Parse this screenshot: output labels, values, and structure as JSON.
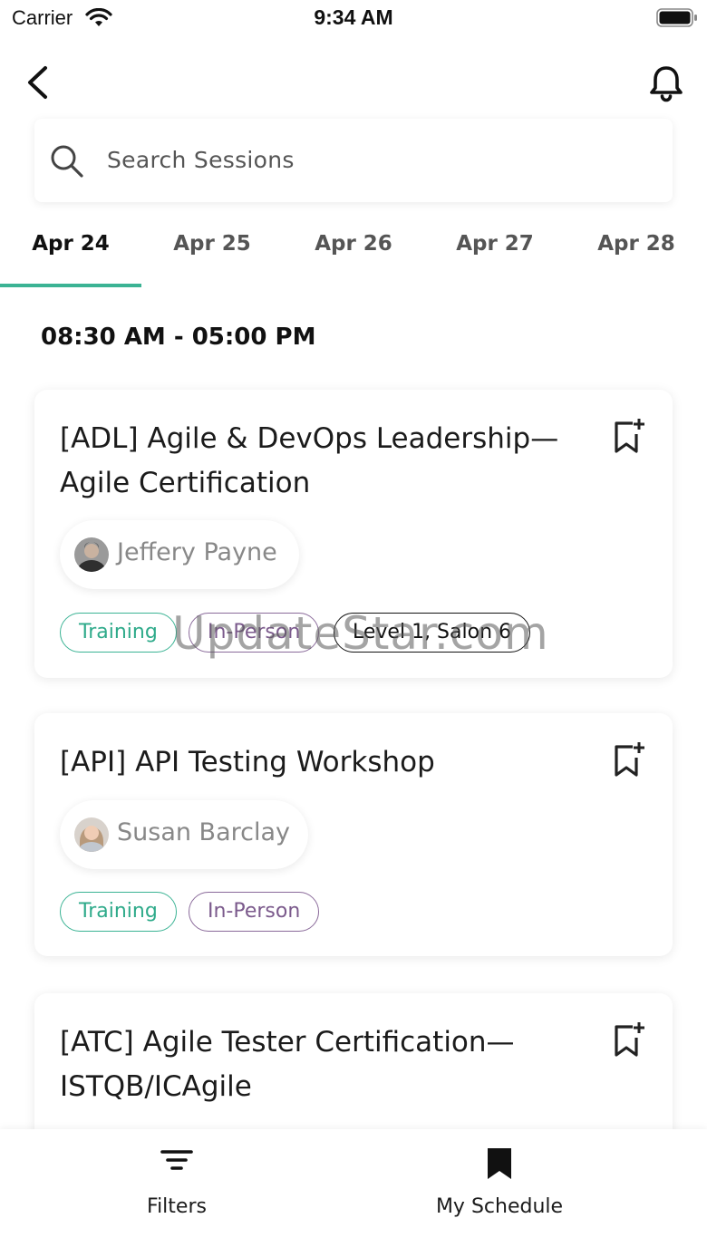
{
  "status_bar": {
    "carrier": "Carrier",
    "time": "9:34 AM"
  },
  "search": {
    "placeholder": "Search Sessions"
  },
  "date_tabs": [
    {
      "label": "Apr 24",
      "active": true
    },
    {
      "label": "Apr 25",
      "active": false
    },
    {
      "label": "Apr 26",
      "active": false
    },
    {
      "label": "Apr 27",
      "active": false
    },
    {
      "label": "Apr 28",
      "active": false
    }
  ],
  "time_slot": "08:30 AM -  05:00 PM",
  "sessions": [
    {
      "title_line1": "[ADL] Agile & DevOps Leadership—",
      "title_line2": "Agile Certification",
      "speaker": "Jeffery Payne",
      "tags": {
        "type": "Training",
        "format": "In-Person",
        "location": "Level 1, Salon 6"
      }
    },
    {
      "title_line1": "[API] API Testing Workshop",
      "speaker": "Susan Barclay",
      "tags": {
        "type": "Training",
        "format": "In-Person"
      }
    },
    {
      "title_line1": "[ATC] Agile Tester Certification—",
      "title_line2": "ISTQB/ICAgile"
    }
  ],
  "watermark": "UpdateStar.com",
  "bottom_nav": {
    "filters_label": "Filters",
    "schedule_label": "My Schedule"
  },
  "colors": {
    "accent": "#3bb394",
    "in_person": "#8a6a9a",
    "text": "#1b1b1b"
  },
  "icons": [
    "back-arrow-icon",
    "bell-icon",
    "search-icon",
    "bookmark-add-icon",
    "filter-icon",
    "bookmark-filled-icon"
  ]
}
